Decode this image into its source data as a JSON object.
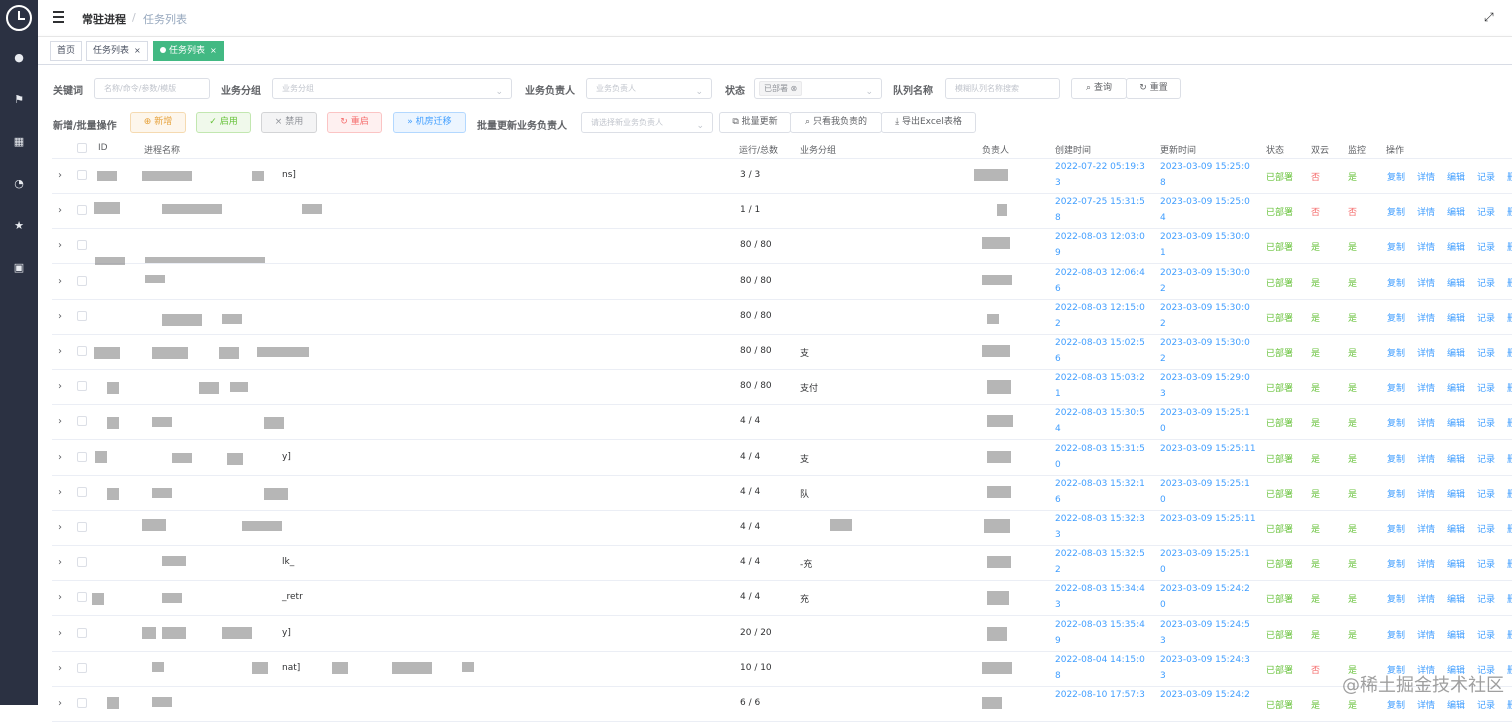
{
  "topbar": {
    "crumb_parent": "常驻进程",
    "crumb_separator": "/",
    "crumb_current": "任务列表"
  },
  "tags": [
    "首页",
    "任务列表",
    "任务列表"
  ],
  "filters": {
    "keyword_label": "关键词",
    "keyword_placeholder": "名称/命令/参数/模版",
    "group_label": "业务分组",
    "group_placeholder": "业务分组",
    "owner_label": "业务负责人",
    "owner_placeholder": "业务负责人",
    "status_label": "状态",
    "status_value": "已部署",
    "queue_label": "队列名称",
    "queue_placeholder": "模糊队列名称搜索",
    "query_button": "查询",
    "reset_button": "重置"
  },
  "actions": {
    "batch_label": "新增/批量操作",
    "add": "新增",
    "enable": "启用",
    "disable": "禁用",
    "restart": "重启",
    "migrate": "机房迁移",
    "batch_owner_label": "批量更新业务负责人",
    "owner_select_placeholder": "请选择新业务负责人",
    "batch_update": "批量更新",
    "mine_only": "只看我负责的",
    "export": "导出Excel表格"
  },
  "table": {
    "headers": {
      "id": "ID",
      "name": "进程名称",
      "run": "运行/总数",
      "group": "业务分组",
      "owner": "负责人",
      "created": "创建时间",
      "updated": "更新时间",
      "status": "状态",
      "dual": "双云",
      "monitor": "监控",
      "ops": "操作"
    },
    "ops_labels": [
      "复制",
      "详情",
      "编辑",
      "记录",
      "删"
    ],
    "rows": [
      {
        "name": "ns]",
        "run": "3 / 3",
        "group": "",
        "c1": "2022-07-22 05:19:3",
        "c2": "3",
        "u1": "2023-03-09 15:25:0",
        "u2": "8",
        "status": "已部署",
        "dual": "否",
        "monitor": "是"
      },
      {
        "name": "",
        "run": "1 / 1",
        "group": "",
        "c1": "2022-07-25 15:31:5",
        "c2": "8",
        "u1": "2023-03-09 15:25:0",
        "u2": "4",
        "status": "已部署",
        "dual": "否",
        "monitor": "否"
      },
      {
        "name": "",
        "run": "80 / 80",
        "group": "",
        "c1": "2022-08-03 12:03:0",
        "c2": "9",
        "u1": "2023-03-09 15:30:0",
        "u2": "1",
        "status": "已部署",
        "dual": "是",
        "monitor": "是"
      },
      {
        "name": "",
        "run": "80 / 80",
        "group": "",
        "c1": "2022-08-03 12:06:4",
        "c2": "6",
        "u1": "2023-03-09 15:30:0",
        "u2": "2",
        "status": "已部署",
        "dual": "是",
        "monitor": "是"
      },
      {
        "name": "",
        "run": "80 / 80",
        "group": "",
        "c1": "2022-08-03 12:15:0",
        "c2": "2",
        "u1": "2023-03-09 15:30:0",
        "u2": "2",
        "status": "已部署",
        "dual": "是",
        "monitor": "是"
      },
      {
        "name": "",
        "run": "80 / 80",
        "group": "支",
        "c1": "2022-08-03 15:02:5",
        "c2": "6",
        "u1": "2023-03-09 15:30:0",
        "u2": "2",
        "status": "已部署",
        "dual": "是",
        "monitor": "是"
      },
      {
        "name": "",
        "run": "80 / 80",
        "group": "支付",
        "c1": "2022-08-03 15:03:2",
        "c2": "1",
        "u1": "2023-03-09 15:29:0",
        "u2": "3",
        "status": "已部署",
        "dual": "是",
        "monitor": "是"
      },
      {
        "name": "",
        "run": "4 / 4",
        "group": "",
        "c1": "2022-08-03 15:30:5",
        "c2": "4",
        "u1": "2023-03-09 15:25:1",
        "u2": "0",
        "status": "已部署",
        "dual": "是",
        "monitor": "是"
      },
      {
        "name": "y]",
        "run": "4 / 4",
        "group": "支",
        "c1": "2022-08-03 15:31:5",
        "c2": "0",
        "u1": "2023-03-09 15:25:11",
        "u2": "",
        "status": "已部署",
        "dual": "是",
        "monitor": "是"
      },
      {
        "name": "",
        "run": "4 / 4",
        "group": "队",
        "c1": "2022-08-03 15:32:1",
        "c2": "6",
        "u1": "2023-03-09 15:25:1",
        "u2": "0",
        "status": "已部署",
        "dual": "是",
        "monitor": "是"
      },
      {
        "name": "",
        "run": "4 / 4",
        "group": "",
        "c1": "2022-08-03 15:32:3",
        "c2": "3",
        "u1": "2023-03-09 15:25:11",
        "u2": "",
        "status": "已部署",
        "dual": "是",
        "monitor": "是"
      },
      {
        "name": "lk_",
        "run": "4 / 4",
        "group": "-充",
        "c1": "2022-08-03 15:32:5",
        "c2": "2",
        "u1": "2023-03-09 15:25:1",
        "u2": "0",
        "status": "已部署",
        "dual": "是",
        "monitor": "是"
      },
      {
        "name": "_retr",
        "run": "4 / 4",
        "group": "充",
        "c1": "2022-08-03 15:34:4",
        "c2": "3",
        "u1": "2023-03-09 15:24:2",
        "u2": "0",
        "status": "已部署",
        "dual": "是",
        "monitor": "是"
      },
      {
        "name": "y]",
        "run": "20 / 20",
        "group": "",
        "c1": "2022-08-03 15:35:4",
        "c2": "9",
        "u1": "2023-03-09 15:24:5",
        "u2": "3",
        "status": "已部署",
        "dual": "是",
        "monitor": "是"
      },
      {
        "name": "nat]",
        "run": "10 / 10",
        "group": "",
        "c1": "2022-08-04 14:15:0",
        "c2": "8",
        "u1": "2023-03-09 15:24:3",
        "u2": "3",
        "status": "已部署",
        "dual": "否",
        "monitor": "是"
      },
      {
        "name": "",
        "run": "6 / 6",
        "group": "",
        "c1": "2022-08-10 17:57:3",
        "c2": "",
        "u1": "2023-03-09 15:24:2",
        "u2": "",
        "status": "已部署",
        "dual": "是",
        "monitor": "是"
      }
    ]
  },
  "watermark": "@稀土掘金技术社区",
  "colors": {
    "accent": "#409eff",
    "success": "#67c23a",
    "danger": "#f56c6c",
    "tag_active": "#42b983",
    "sidebar": "#2b3142"
  }
}
